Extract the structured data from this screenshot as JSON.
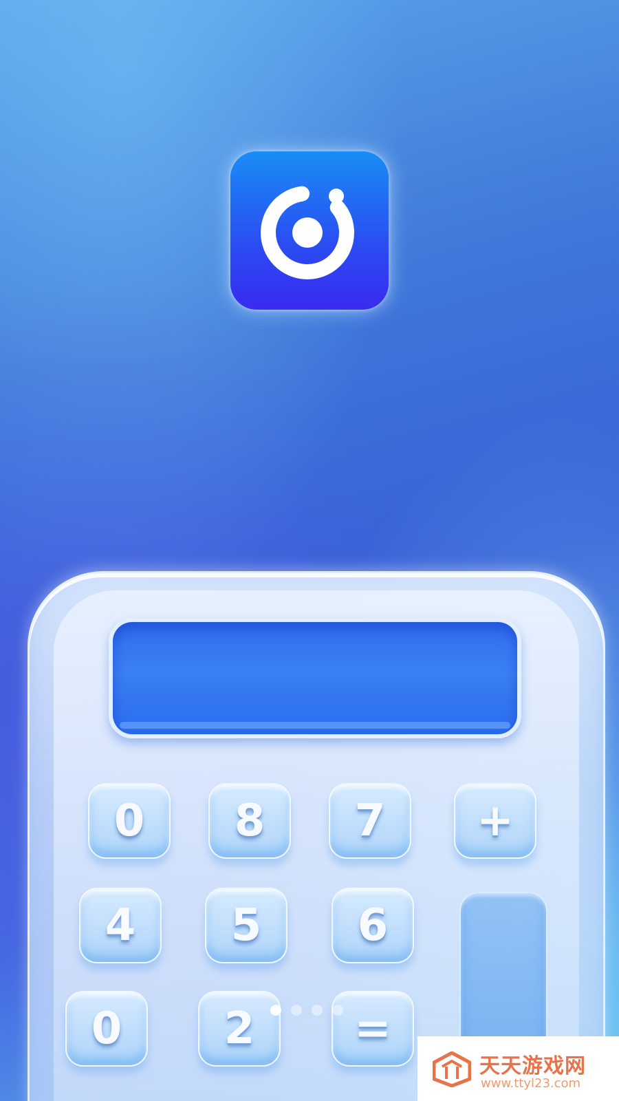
{
  "screen": {
    "type": "splash-screen",
    "colors": {
      "background_top": "#5aa6ea",
      "background_mid": "#3a5fd6",
      "app_icon_top": "#1a8df5",
      "app_icon_bottom": "#3a2bf0",
      "display": "#2f6ff0",
      "watermark_accent": "#e8734a"
    }
  },
  "app_icon": {
    "icon": "app-logo-ring-icon"
  },
  "calculator": {
    "keys": [
      {
        "label": "0"
      },
      {
        "label": "8"
      },
      {
        "label": "7"
      },
      {
        "label": "+"
      },
      {
        "label": "4"
      },
      {
        "label": "5"
      },
      {
        "label": "6"
      },
      {
        "label": "0"
      },
      {
        "label": "2"
      },
      {
        "label": "="
      }
    ]
  },
  "pager": {
    "count": 4,
    "active_index": 0
  },
  "watermark": {
    "title": "天天游戏网",
    "url": "www.ttyl23.com",
    "icon": "watermark-logo-icon"
  }
}
